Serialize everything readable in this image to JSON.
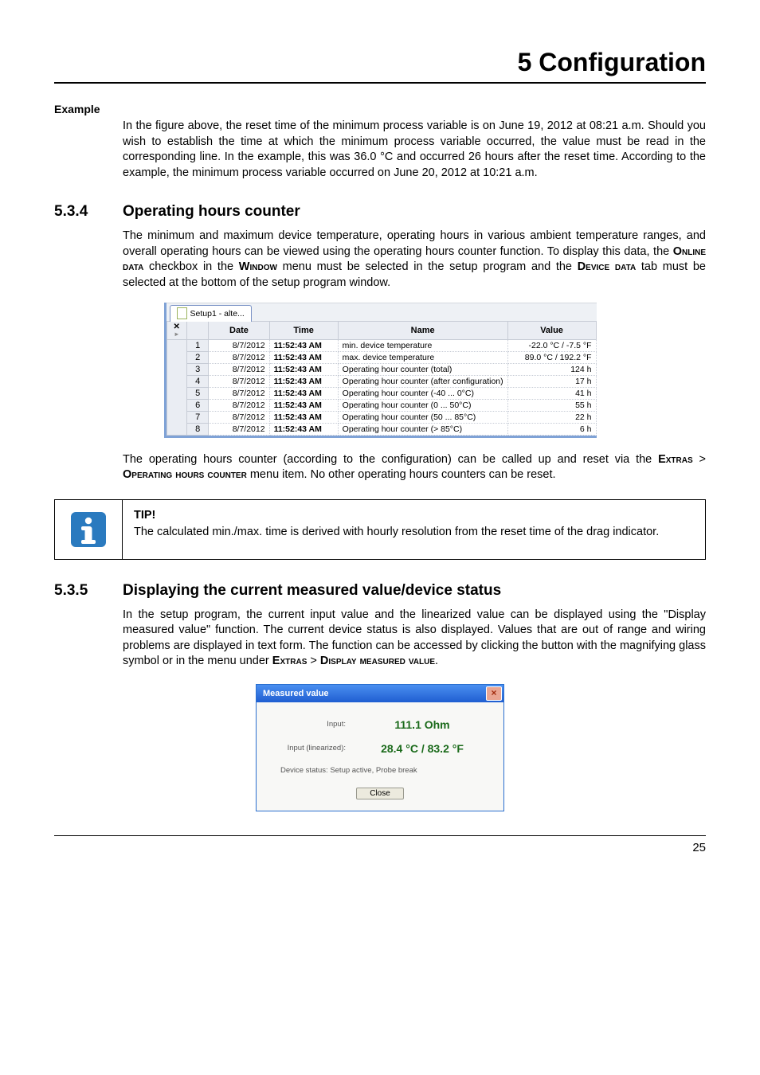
{
  "chapter_title": "5 Configuration",
  "page_number": "25",
  "example": {
    "label": "Example",
    "text": "In the figure above, the reset time of the minimum process variable is on June 19, 2012 at 08:21 a.m. Should you wish to establish the time at which the minimum process variable occurred, the value must be read in the corresponding line. In the example, this was 36.0 °C and occurred 26 hours after the reset time. According to the example, the minimum process variable occurred on June 20, 2012 at 10:21 a.m."
  },
  "sec534": {
    "num": "5.3.4",
    "title": "Operating hours counter",
    "para1_a": "The minimum and maximum device temperature, operating hours in various ambient temperature ranges, and overall operating hours can be viewed using the operating hours counter function. To display this data, the ",
    "para1_b": " checkbox in the ",
    "para1_c": " menu must be selected in the setup program and the ",
    "para1_d": " tab must be selected at the bottom of the setup program window.",
    "caps_online": "Online data",
    "caps_window": "Window",
    "caps_device": "Device data",
    "para2_a": "The operating hours counter (according to the configuration) can be called up and reset via the ",
    "para2_b": " menu item. No other operating hours counters can be reset.",
    "caps_extras": "Extras",
    "gt": " > ",
    "caps_opcounter": "Operating hours counter"
  },
  "shot1": {
    "tab_label": "Setup1 - alte...",
    "headers": {
      "h0": "",
      "h1": "Date",
      "h2": "Time",
      "h3": "Name",
      "h4": "Value"
    },
    "rows": [
      {
        "n": "1",
        "date": "8/7/2012",
        "time": "11:52:43 AM",
        "name": "min. device temperature",
        "value": "-22.0 °C / -7.5 °F"
      },
      {
        "n": "2",
        "date": "8/7/2012",
        "time": "11:52:43 AM",
        "name": "max. device temperature",
        "value": "89.0 °C / 192.2 °F"
      },
      {
        "n": "3",
        "date": "8/7/2012",
        "time": "11:52:43 AM",
        "name": "Operating hour counter (total)",
        "value": "124 h"
      },
      {
        "n": "4",
        "date": "8/7/2012",
        "time": "11:52:43 AM",
        "name": "Operating hour counter (after configuration)",
        "value": "17 h"
      },
      {
        "n": "5",
        "date": "8/7/2012",
        "time": "11:52:43 AM",
        "name": "Operating hour counter (-40 ... 0°C)",
        "value": "41 h"
      },
      {
        "n": "6",
        "date": "8/7/2012",
        "time": "11:52:43 AM",
        "name": "Operating hour counter (0 ... 50°C)",
        "value": "55 h"
      },
      {
        "n": "7",
        "date": "8/7/2012",
        "time": "11:52:43 AM",
        "name": "Operating hour counter (50 ... 85°C)",
        "value": "22 h"
      },
      {
        "n": "8",
        "date": "8/7/2012",
        "time": "11:52:43 AM",
        "name": "Operating hour counter (> 85°C)",
        "value": "6 h"
      }
    ]
  },
  "tip": {
    "label": "TIP!",
    "text": "The calculated min./max. time is derived with hourly resolution from the reset time of the drag indicator."
  },
  "sec535": {
    "num": "5.3.5",
    "title": "Displaying the current measured value/device status",
    "para_a": "In the setup program, the current input value and the linearized value can be displayed using the \"Display measured value\" function. The current device status is also displayed. Values that are out of range and wiring problems are displayed in text form. The function can be accessed by clicking the button with the magnifying glass symbol or in the menu under ",
    "caps_extras": "Extras",
    "gt": " > ",
    "caps_display": "Display measured value",
    "dot": "."
  },
  "shot2": {
    "title": "Measured value",
    "row1_label": "Input:",
    "row1_value": "111.1 Ohm",
    "row2_label": "Input (linearized):",
    "row2_value": "28.4 °C / 83.2 °F",
    "status_label": "Device status:",
    "status_value": "Setup active, Probe break",
    "close": "Close"
  }
}
